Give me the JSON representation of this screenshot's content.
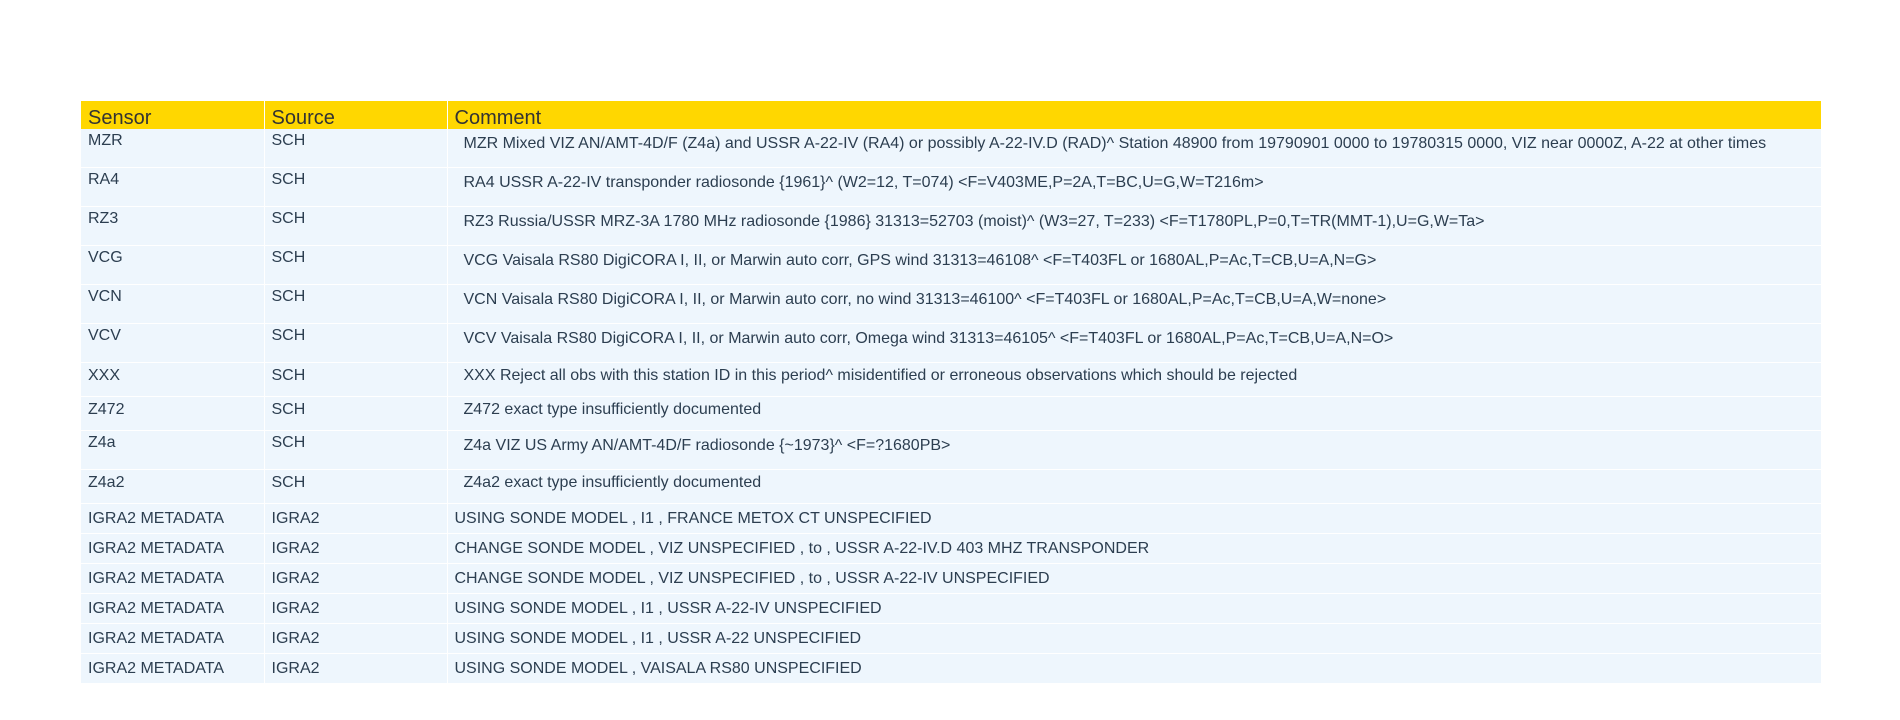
{
  "table": {
    "headers": {
      "sensor": "Sensor",
      "source": "Source",
      "comment": "Comment"
    },
    "rows": [
      {
        "sensor": "MZR",
        "source": "SCH",
        "comment": "MZR Mixed VIZ AN/AMT-4D/F (Z4a) and USSR A-22-IV (RA4) or possibly A-22-IV.D (RAD)^ Station 48900 from 19790901 0000 to 19780315 0000, VIZ near 0000Z, A-22 at other times"
      },
      {
        "sensor": "RA4",
        "source": "SCH",
        "comment": "RA4 USSR A-22-IV transponder radiosonde {1961}^ (W2=12, T=074) <F=V403ME,P=2A,T=BC,U=G,W=T216m>"
      },
      {
        "sensor": "RZ3",
        "source": "SCH",
        "comment": "RZ3 Russia/USSR MRZ-3A 1780 MHz radiosonde {1986} 31313=52703 (moist)^ (W3=27, T=233) <F=T1780PL,P=0,T=TR(MMT-1),U=G,W=Ta>"
      },
      {
        "sensor": "VCG",
        "source": "SCH",
        "comment": "VCG Vaisala RS80 DigiCORA I, II, or Marwin auto corr, GPS wind 31313=46108^ <F=T403FL or 1680AL,P=Ac,T=CB,U=A,N=G>"
      },
      {
        "sensor": "VCN",
        "source": "SCH",
        "comment": "VCN Vaisala RS80 DigiCORA I, II, or Marwin auto corr, no wind 31313=46100^ <F=T403FL or 1680AL,P=Ac,T=CB,U=A,W=none>"
      },
      {
        "sensor": "VCV",
        "source": "SCH",
        "comment": "VCV Vaisala RS80 DigiCORA I, II, or Marwin auto corr, Omega wind 31313=46105^ <F=T403FL or 1680AL,P=Ac,T=CB,U=A,N=O>"
      },
      {
        "sensor": "XXX",
        "source": "SCH",
        "comment": "XXX Reject all obs with this station ID in this period^ misidentified or erroneous observations which should be rejected"
      },
      {
        "sensor": "Z472",
        "source": "SCH",
        "comment": "Z472 exact type insufficiently documented"
      },
      {
        "sensor": "Z4a",
        "source": "SCH",
        "comment": "Z4a VIZ US Army AN/AMT-4D/F radiosonde {~1973}^ <F=?1680PB>"
      },
      {
        "sensor": "Z4a2",
        "source": "SCH",
        "comment": "Z4a2 exact type insufficiently documented"
      },
      {
        "sensor": "IGRA2 METADATA",
        "source": "IGRA2",
        "comment": "USING SONDE MODEL , I1 , FRANCE METOX CT UNSPECIFIED"
      },
      {
        "sensor": "IGRA2 METADATA",
        "source": "IGRA2",
        "comment": "CHANGE SONDE MODEL , VIZ UNSPECIFIED , to , USSR A-22-IV.D 403 MHZ TRANSPONDER"
      },
      {
        "sensor": "IGRA2 METADATA",
        "source": "IGRA2",
        "comment": "CHANGE SONDE MODEL , VIZ UNSPECIFIED , to , USSR A-22-IV UNSPECIFIED"
      },
      {
        "sensor": "IGRA2 METADATA",
        "source": "IGRA2",
        "comment": "USING SONDE MODEL , I1 , USSR A-22-IV UNSPECIFIED"
      },
      {
        "sensor": "IGRA2 METADATA",
        "source": "IGRA2",
        "comment": "USING SONDE MODEL , I1 , USSR A-22 UNSPECIFIED"
      },
      {
        "sensor": "IGRA2 METADATA",
        "source": "IGRA2",
        "comment": "USING SONDE MODEL , VAISALA RS80 UNSPECIFIED"
      }
    ]
  },
  "colors": {
    "header_bg": "#ffd700",
    "row_bg": "#eef6fd",
    "text": "#2c3e50"
  }
}
